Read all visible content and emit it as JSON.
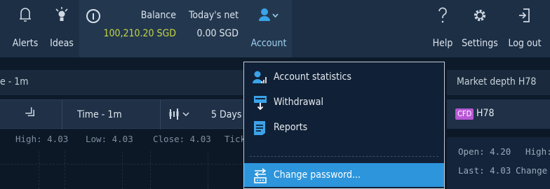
{
  "topbar": {
    "alerts_label": "Alerts",
    "ideas_label": "Ideas",
    "balance_label": "Balance",
    "balance_value": "100,210.20 SGD",
    "todays_net_label": "Today's net",
    "todays_net_value": "0.00 SGD",
    "account_label": "Account",
    "help_label": "Help",
    "settings_label": "Settings",
    "logout_label": "Log out",
    "icons": [
      "bell-icon",
      "lightbulb-icon",
      "info-icon",
      "user-icon",
      "chevron-down-icon",
      "question-icon",
      "gear-icon",
      "logout-icon"
    ]
  },
  "chart": {
    "header_title": "e - 1m",
    "toolbar": {
      "timeframe": "Time - 1m",
      "range": "5 Days"
    },
    "ohlc": {
      "high": "High: 4.03",
      "low": "Low: 4.03",
      "close": "Close: 4.03",
      "ticks": "Ticks"
    }
  },
  "depth": {
    "header_title": "Market depth H78",
    "badge": "CFD",
    "symbol": "H78",
    "open": "Open: 4.20",
    "high": "High:",
    "last": "Last: 4.03",
    "change": "Change"
  },
  "account_menu": {
    "items": [
      {
        "label": "Account statistics",
        "icon": "account-stats-icon"
      },
      {
        "label": "Withdrawal",
        "icon": "withdrawal-icon"
      },
      {
        "label": "Reports",
        "icon": "reports-icon"
      },
      {
        "label": "Change password...",
        "icon": "change-password-icon",
        "highlighted": true
      }
    ]
  },
  "colors": {
    "topbar_bg": "#1d2f45",
    "balance_value": "#c6d646",
    "accent": "#2c95dc",
    "account_label": "#9fd0f2",
    "cfd_badge": "#b957d6",
    "page_bg": "#0d1a2a"
  }
}
